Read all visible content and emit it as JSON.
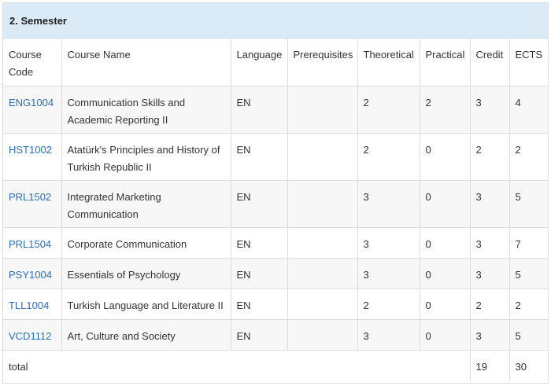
{
  "panel": {
    "title": "2. Semester"
  },
  "table": {
    "headers": {
      "code_line1": "Course",
      "code_line2": "Code",
      "name": "Course Name",
      "language": "Language",
      "prerequisites": "Prerequisites",
      "theoretical": "Theoretical",
      "practical": "Practical",
      "credit": "Credit",
      "ects": "ECTS"
    },
    "rows": [
      {
        "code": "ENG1004",
        "name_line1": "Communication Skills and",
        "name_line2": "Academic Reporting II",
        "language": "EN",
        "prerequisites": "",
        "theoretical": "2",
        "practical": "2",
        "credit": "3",
        "ects": "4"
      },
      {
        "code": "HST1002",
        "name_line1": "Atatürk's Principles and History of",
        "name_line2": "Turkish Republic II",
        "language": "EN",
        "prerequisites": "",
        "theoretical": "2",
        "practical": "0",
        "credit": "2",
        "ects": "2"
      },
      {
        "code": "PRL1502",
        "name_line1": "Integrated Marketing",
        "name_line2": "Communication",
        "language": "EN",
        "prerequisites": "",
        "theoretical": "3",
        "practical": "0",
        "credit": "3",
        "ects": "5"
      },
      {
        "code": "PRL1504",
        "name_line1": "Corporate Communication",
        "name_line2": "",
        "language": "EN",
        "prerequisites": "",
        "theoretical": "3",
        "practical": "0",
        "credit": "3",
        "ects": "7"
      },
      {
        "code": "PSY1004",
        "name_line1": "Essentials of Psychology",
        "name_line2": "",
        "language": "EN",
        "prerequisites": "",
        "theoretical": "3",
        "practical": "0",
        "credit": "3",
        "ects": "5"
      },
      {
        "code": "TLL1004",
        "name_line1": "Turkish Language and Literature II",
        "name_line2": "",
        "language": "EN",
        "prerequisites": "",
        "theoretical": "2",
        "practical": "0",
        "credit": "2",
        "ects": "2"
      },
      {
        "code": "VCD1112",
        "name_line1": "Art, Culture and Society",
        "name_line2": "",
        "language": "EN",
        "prerequisites": "",
        "theoretical": "3",
        "practical": "0",
        "credit": "3",
        "ects": "5"
      }
    ],
    "total": {
      "label": "total",
      "credit": "19",
      "ects": "30"
    }
  },
  "colors": {
    "heading_bg": "#daeaf7",
    "link": "#2a6ebd",
    "stripe": "#f7f7f7",
    "border": "#dddddd"
  }
}
